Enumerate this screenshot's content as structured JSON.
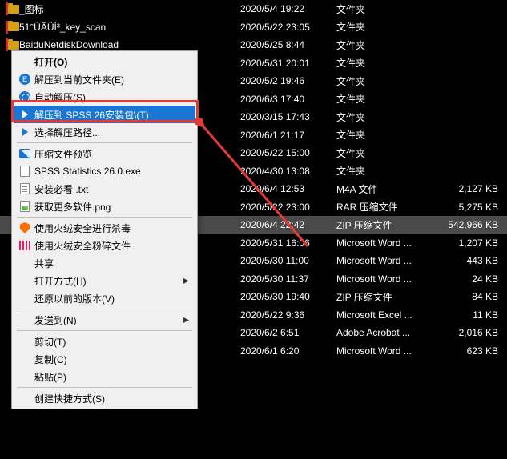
{
  "rows": [
    {
      "name": "_图标",
      "date": "2020/5/4 19:22",
      "type": "文件夹",
      "size": "",
      "icon": "folder",
      "bar": true
    },
    {
      "name": "51°ÚÂÛÌ³_key_scan",
      "date": "2020/5/22 23:05",
      "type": "文件夹",
      "size": "",
      "icon": "folder",
      "bar": true
    },
    {
      "name": "BaiduNetdiskDownload",
      "date": "2020/5/25 8:44",
      "type": "文件夹",
      "size": "",
      "icon": "folder",
      "bar": true
    },
    {
      "name": "",
      "date": "2020/5/31 20:01",
      "type": "文件夹",
      "size": ""
    },
    {
      "name": "",
      "date": "2020/5/2 19:46",
      "type": "文件夹",
      "size": ""
    },
    {
      "name": "",
      "date": "2020/6/3 17:40",
      "type": "文件夹",
      "size": ""
    },
    {
      "name": "",
      "date": "2020/3/15 17:43",
      "type": "文件夹",
      "size": ""
    },
    {
      "name": "",
      "date": "2020/6/1 21:17",
      "type": "文件夹",
      "size": ""
    },
    {
      "name": "",
      "date": "2020/5/22 15:00",
      "type": "文件夹",
      "size": ""
    },
    {
      "name": "",
      "date": "2020/4/30 13:08",
      "type": "文件夹",
      "size": ""
    },
    {
      "name": "",
      "date": "2020/6/4 12:53",
      "type": "M4A 文件",
      "size": "2,127 KB"
    },
    {
      "name": "",
      "date": "2020/5/22 23:00",
      "type": "RAR 压缩文件",
      "size": "5,275 KB"
    },
    {
      "name": "",
      "date": "2020/6/4 22:42",
      "type": "ZIP 压缩文件",
      "size": "542,966 KB",
      "hl": true
    },
    {
      "name": "",
      "date": "2020/5/31 16:06",
      "type": "Microsoft Word ...",
      "size": "1,207 KB"
    },
    {
      "name": "",
      "date": "2020/5/30 11:00",
      "type": "Microsoft Word ...",
      "size": "443 KB"
    },
    {
      "name": "",
      "date": "2020/5/30 11:37",
      "type": "Microsoft Word ...",
      "size": "24 KB"
    },
    {
      "name": "",
      "date": "2020/5/30 19:40",
      "type": "ZIP 压缩文件",
      "size": "84 KB"
    },
    {
      "name": "",
      "date": "2020/5/22 9:36",
      "type": "Microsoft Excel ...",
      "size": "11 KB"
    },
    {
      "name": "",
      "date": "2020/6/2 6:51",
      "type": "Adobe Acrobat ...",
      "size": "2,016 KB"
    },
    {
      "name": "",
      "date": "2020/6/1 6:20",
      "type": "Microsoft Word ...",
      "size": "623 KB"
    }
  ],
  "menu": {
    "open": "打开(O)",
    "extract_here": "解压到当前文件夹(E)",
    "auto_extract": "自动解压(S)",
    "extract_to": "解压到 SPSS 26安装包\\(T)",
    "choose_path": "选择解压路径...",
    "preview": "压缩文件预览",
    "file1": "SPSS Statistics 26.0.exe",
    "file2": "安装必看 .txt",
    "file3": "获取更多软件.png",
    "antivirus": "使用火绒安全进行杀毒",
    "shred": "使用火绒安全粉碎文件",
    "share": "共享",
    "open_with": "打开方式(H)",
    "restore": "还原以前的版本(V)",
    "send_to": "发送到(N)",
    "cut": "剪切(T)",
    "copy": "复制(C)",
    "paste": "粘贴(P)",
    "shortcut": "创建快捷方式(S)"
  }
}
